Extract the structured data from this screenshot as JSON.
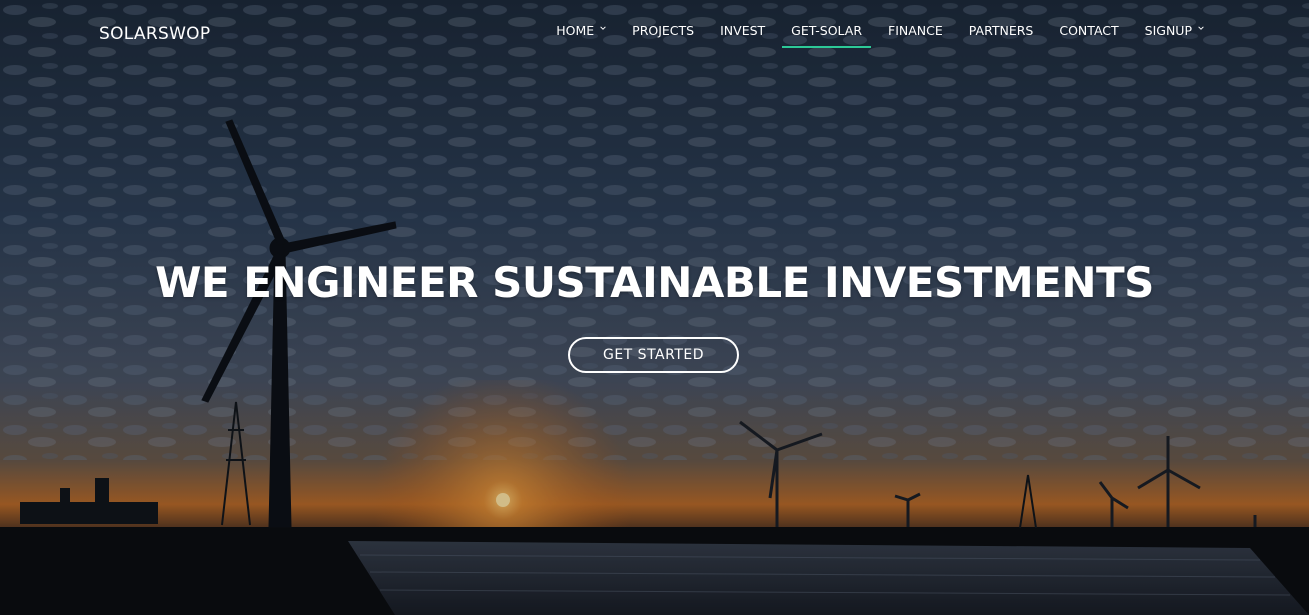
{
  "brand": {
    "logo_text": "SOLARSWOP"
  },
  "nav": {
    "items": [
      {
        "label": "HOME",
        "has_dropdown": true
      },
      {
        "label": "PROJECTS",
        "has_dropdown": false
      },
      {
        "label": "INVEST",
        "has_dropdown": false
      },
      {
        "label": "GET-SOLAR",
        "has_dropdown": false,
        "active": true
      },
      {
        "label": "FINANCE",
        "has_dropdown": false
      },
      {
        "label": "PARTNERS",
        "has_dropdown": false
      },
      {
        "label": "CONTACT",
        "has_dropdown": false
      },
      {
        "label": "SIGNUP",
        "has_dropdown": true
      }
    ],
    "active_underline_color": "#2dc997"
  },
  "hero": {
    "headline": "WE ENGINEER SUSTAINABLE INVESTMENTS",
    "cta_label": "GET STARTED",
    "background": "sunset-wind-turbines-solar-panels-photo"
  }
}
